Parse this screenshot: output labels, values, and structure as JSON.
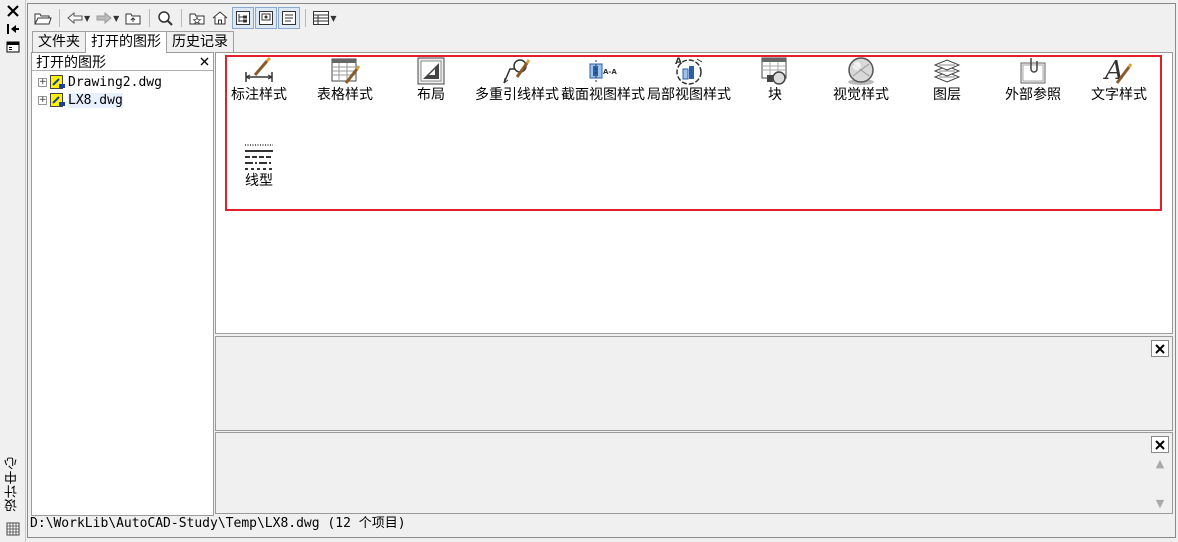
{
  "palette": {
    "title": "设计中心"
  },
  "tabs": [
    {
      "label": "文件夹"
    },
    {
      "label": "打开的图形"
    },
    {
      "label": "历史记录"
    }
  ],
  "left_panel": {
    "title": "打开的图形",
    "items": [
      {
        "label": "Drawing2.dwg"
      },
      {
        "label": "LX8.dwg"
      }
    ]
  },
  "content_items": [
    {
      "label": "标注样式",
      "icon": "dimension-style-icon"
    },
    {
      "label": "表格样式",
      "icon": "table-style-icon"
    },
    {
      "label": "布局",
      "icon": "layout-icon"
    },
    {
      "label": "多重引线样式",
      "icon": "multileader-style-icon"
    },
    {
      "label": "截面视图样式",
      "icon": "section-view-style-icon"
    },
    {
      "label": "局部视图样式",
      "icon": "detail-view-style-icon"
    },
    {
      "label": "块",
      "icon": "block-icon"
    },
    {
      "label": "视觉样式",
      "icon": "visual-style-icon"
    },
    {
      "label": "图层",
      "icon": "layer-icon"
    },
    {
      "label": "外部参照",
      "icon": "xref-icon"
    },
    {
      "label": "文字样式",
      "icon": "text-style-icon"
    },
    {
      "label": "线型",
      "icon": "linetype-icon"
    }
  ],
  "status": {
    "text": "D:\\WorkLib\\AutoCAD-Study\\Temp\\LX8.dwg (12 个项目)"
  },
  "colors": {
    "highlight_box": "#e0202a"
  }
}
